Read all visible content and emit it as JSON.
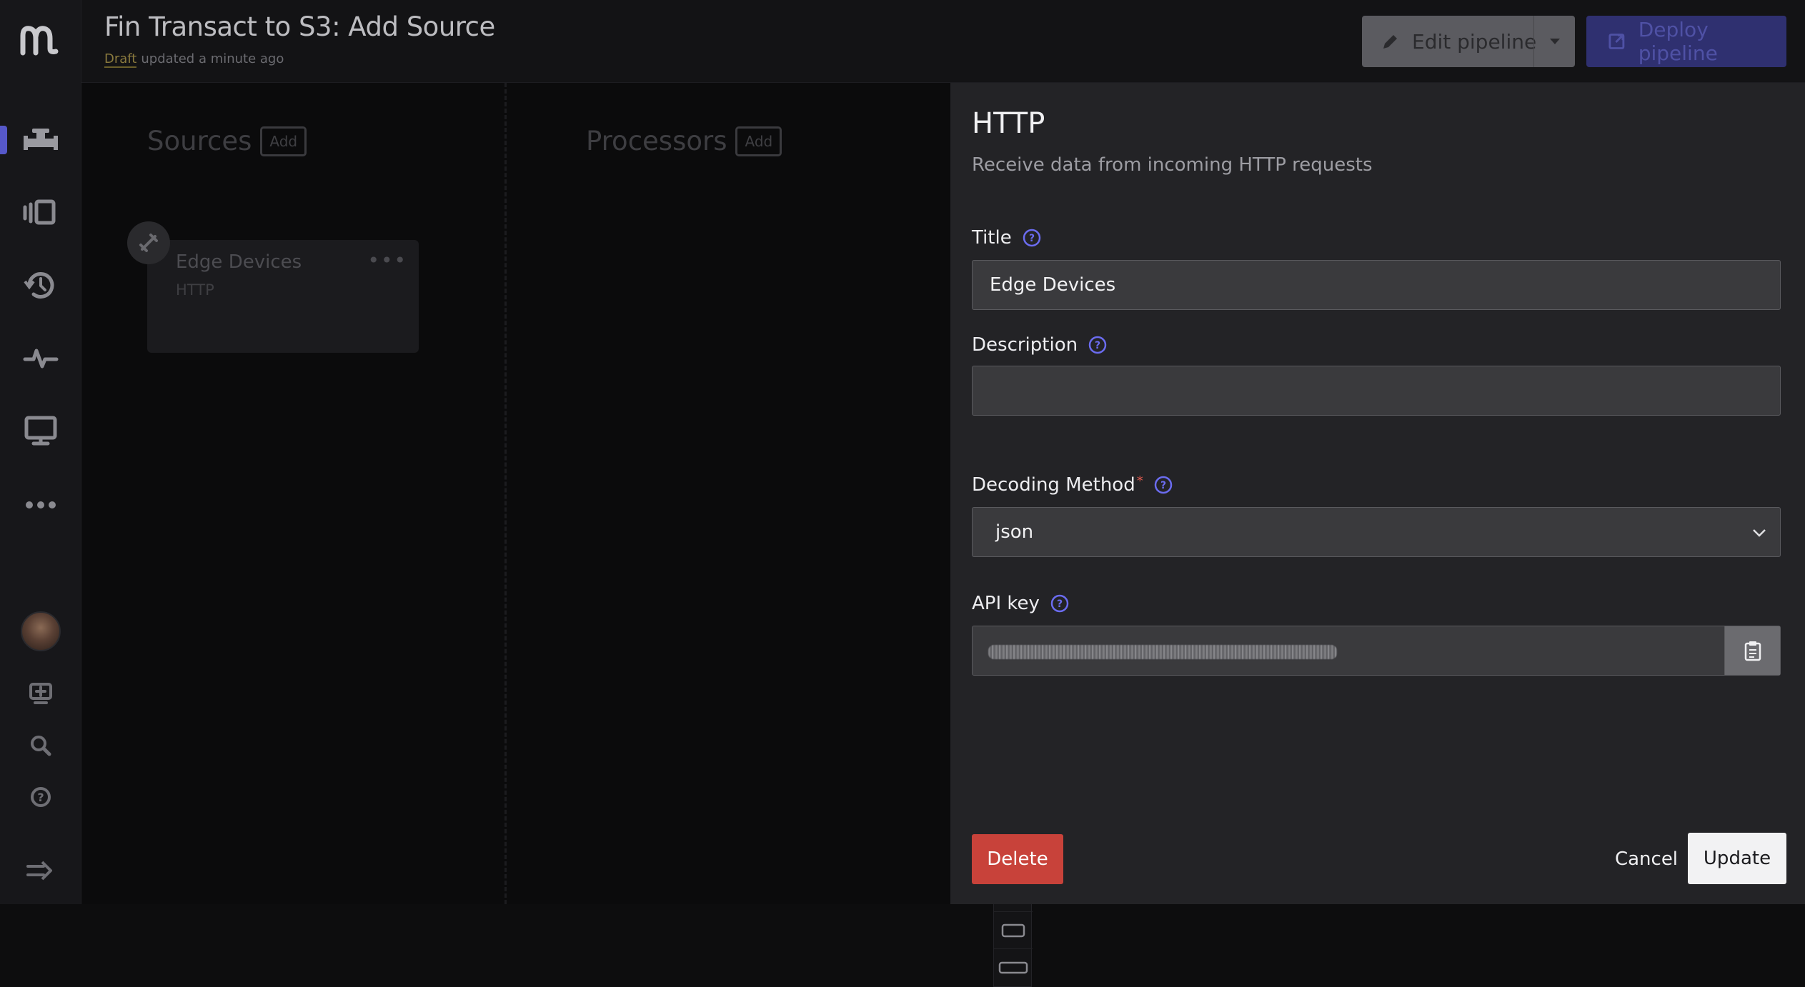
{
  "header": {
    "title": "Fin Transact to S3: Add Source",
    "status_badge": "Draft",
    "updated": "updated a minute ago",
    "edit_label": "Edit pipeline",
    "deploy_label": "Deploy pipeline"
  },
  "rail": {
    "icons": [
      "logo-icon",
      "pipelines-icon",
      "library-icon",
      "history-icon",
      "activity-icon",
      "monitor-icon",
      "more-icon",
      "avatar",
      "feedback-icon",
      "search-icon",
      "help-icon",
      "expand-icon"
    ]
  },
  "canvas": {
    "sources_label": "Sources",
    "processors_label": "Processors",
    "add_label": "Add",
    "card": {
      "title": "Edge Devices",
      "subtitle": "HTTP",
      "menu": "•••"
    }
  },
  "panel": {
    "title": "HTTP",
    "description": "Receive data from incoming HTTP requests",
    "fields": {
      "title_label": "Title",
      "title_value": "Edge Devices",
      "description_label": "Description",
      "description_value": "",
      "decoding_label": "Decoding Method",
      "decoding_required": "*",
      "decoding_value": "json",
      "apikey_label": "API key"
    },
    "delete_label": "Delete",
    "cancel_label": "Cancel",
    "update_label": "Update"
  },
  "colors": {
    "accent": "#5658c9",
    "help_icon": "#6b6cf0",
    "danger": "#c8423a",
    "required": "#e05a4e"
  }
}
